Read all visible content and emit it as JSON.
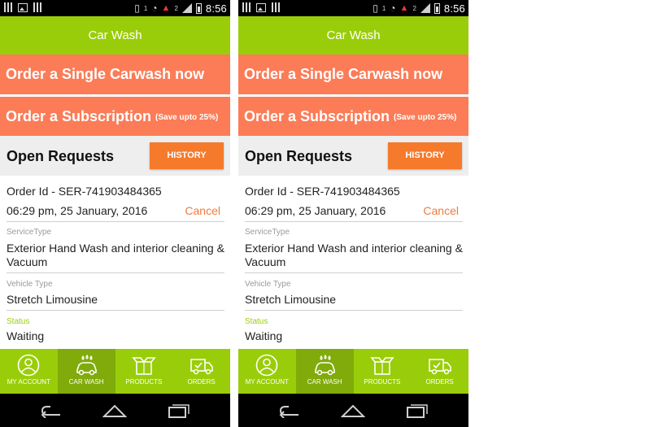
{
  "phones": [
    {
      "status_bar": {
        "time": "8:56",
        "notif1": "1",
        "notif2": "2"
      },
      "header": {
        "title": "Car Wash"
      },
      "actions": {
        "single_label": "Order a Single Carwash now",
        "subscription_label": "Order a Subscription",
        "subscription_note": "(Save upto 25%)"
      },
      "open_requests": {
        "title": "Open Requests",
        "history_label": "HISTORY"
      },
      "order": {
        "id": "Order Id - SER-741903484365",
        "datetime": "06:29 pm, 25 January, 2016",
        "cancel_label": "Cancel",
        "service_type_label": "ServiceType",
        "service_type": "Exterior Hand Wash and interior cleaning & Vacuum",
        "vehicle_type_label": "Vehicle Type",
        "vehicle_type": "Stretch Limousine",
        "status_label": "Status",
        "status": "Waiting"
      },
      "bottom_nav": {
        "items": [
          {
            "label": "MY ACCOUNT",
            "icon": "account-icon"
          },
          {
            "label": "CAR WASH",
            "icon": "car-wash-icon",
            "active": true
          },
          {
            "label": "PRODUCTS",
            "icon": "products-box-icon"
          },
          {
            "label": "ORDERS",
            "icon": "orders-truck-icon"
          }
        ]
      }
    },
    {
      "status_bar": {
        "time": "8:56",
        "notif1": "1",
        "notif2": "2"
      },
      "header": {
        "title": "Car Wash"
      },
      "actions": {
        "single_label": "Order a Single Carwash now",
        "subscription_label": "Order a Subscription",
        "subscription_note": "(Save upto 25%)"
      },
      "open_requests": {
        "title": "Open Requests",
        "history_label": "HISTORY"
      },
      "order": {
        "id": "Order Id - SER-741903484365",
        "datetime": "06:29 pm, 25 January, 2016",
        "cancel_label": "Cancel",
        "service_type_label": "ServiceType",
        "service_type": "Exterior Hand Wash and interior cleaning & Vacuum",
        "vehicle_type_label": "Vehicle Type",
        "vehicle_type": "Stretch Limousine",
        "status_label": "Status",
        "status": "Waiting"
      },
      "bottom_nav": {
        "items": [
          {
            "label": "MY ACCOUNT",
            "icon": "account-icon"
          },
          {
            "label": "CAR WASH",
            "icon": "car-wash-icon",
            "active": true
          },
          {
            "label": "PRODUCTS",
            "icon": "products-box-icon"
          },
          {
            "label": "ORDERS",
            "icon": "orders-truck-icon"
          }
        ]
      }
    }
  ],
  "colors": {
    "brand_green": "#9acd09",
    "active_tab": "#80ab0a",
    "order_button": "#fb7c57",
    "history_button": "#f57a2b",
    "cancel_text": "#f07a3e"
  }
}
